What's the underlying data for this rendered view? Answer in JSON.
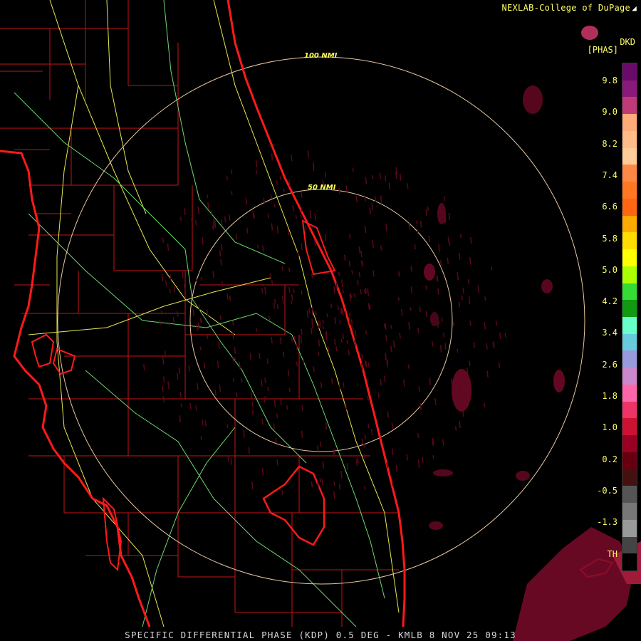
{
  "credit": "NEXLAB-College of DuPage",
  "product": {
    "code": "DKD",
    "unit": "[PHAS]"
  },
  "range_rings": [
    {
      "label": "100 NMI"
    },
    {
      "label": "50 NMI"
    }
  ],
  "caption": "SPECIFIC DIFFERENTIAL PHASE (KDP) 0.5 DEG - KMLB 8 NOV 25 09:13",
  "legend": {
    "ticks": [
      "9.8",
      "9.0",
      "8.2",
      "7.4",
      "6.6",
      "5.8",
      "5.0",
      "4.2",
      "3.4",
      "2.6",
      "1.8",
      "1.0",
      "0.2",
      "-0.5",
      "-1.3",
      "TH"
    ],
    "colors": [
      "#6a0a6a",
      "#8a1a7a",
      "#c03a7a",
      "#ffaa77",
      "#ffbb88",
      "#ffcc99",
      "#ff8844",
      "#ff7722",
      "#ff6611",
      "#ffaa00",
      "#ffdd00",
      "#ffff00",
      "#aaff00",
      "#33dd33",
      "#119911",
      "#66ffcc",
      "#66ccdd",
      "#9999dd",
      "#cc88cc",
      "#ff66aa",
      "#ee3366",
      "#cc1133",
      "#990022",
      "#660011",
      "#441111",
      "#555555",
      "#777777",
      "#999999",
      "#444444",
      "#000000"
    ]
  },
  "colors": {
    "coast": "#ff1a1a",
    "county": "#c81414",
    "roads_green": "#7fe07f",
    "roads_yellow": "#f0f060",
    "rings": "#e8c8a0",
    "echo": "#7a0a2a"
  }
}
